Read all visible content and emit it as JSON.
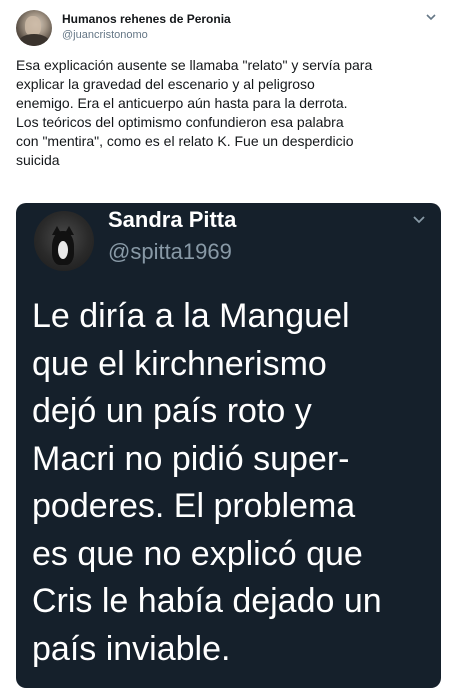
{
  "tweet": {
    "display_name": "Humanos rehenes de Peronia",
    "handle": "@juancristonomo",
    "caret_icon": "chevron-down-icon",
    "text_lines": [
      "Esa explicación ausente se llamaba \"relato\" y servía para",
      "explicar la gravedad del escenario y al peligroso",
      "enemigo. Era el anticuerpo aún hasta para la derrota.",
      "Los teóricos del optimismo confundieron esa palabra",
      "con \"mentira\", como es el relato K.  Fue un desperdicio",
      "suicida"
    ]
  },
  "embedded_tweet": {
    "display_name": "Sandra Pitta",
    "handle": "@spitta1969",
    "caret_icon": "chevron-down-icon",
    "background_color": "#15202b",
    "text_lines": [
      "Le diría a la Manguel",
      "que el kirchnerismo",
      "dejó un país roto y",
      "Macri no pidió super-",
      "poderes. El problema",
      "es que no explicó que",
      "Cris le había dejado un",
      "país inviable."
    ]
  }
}
